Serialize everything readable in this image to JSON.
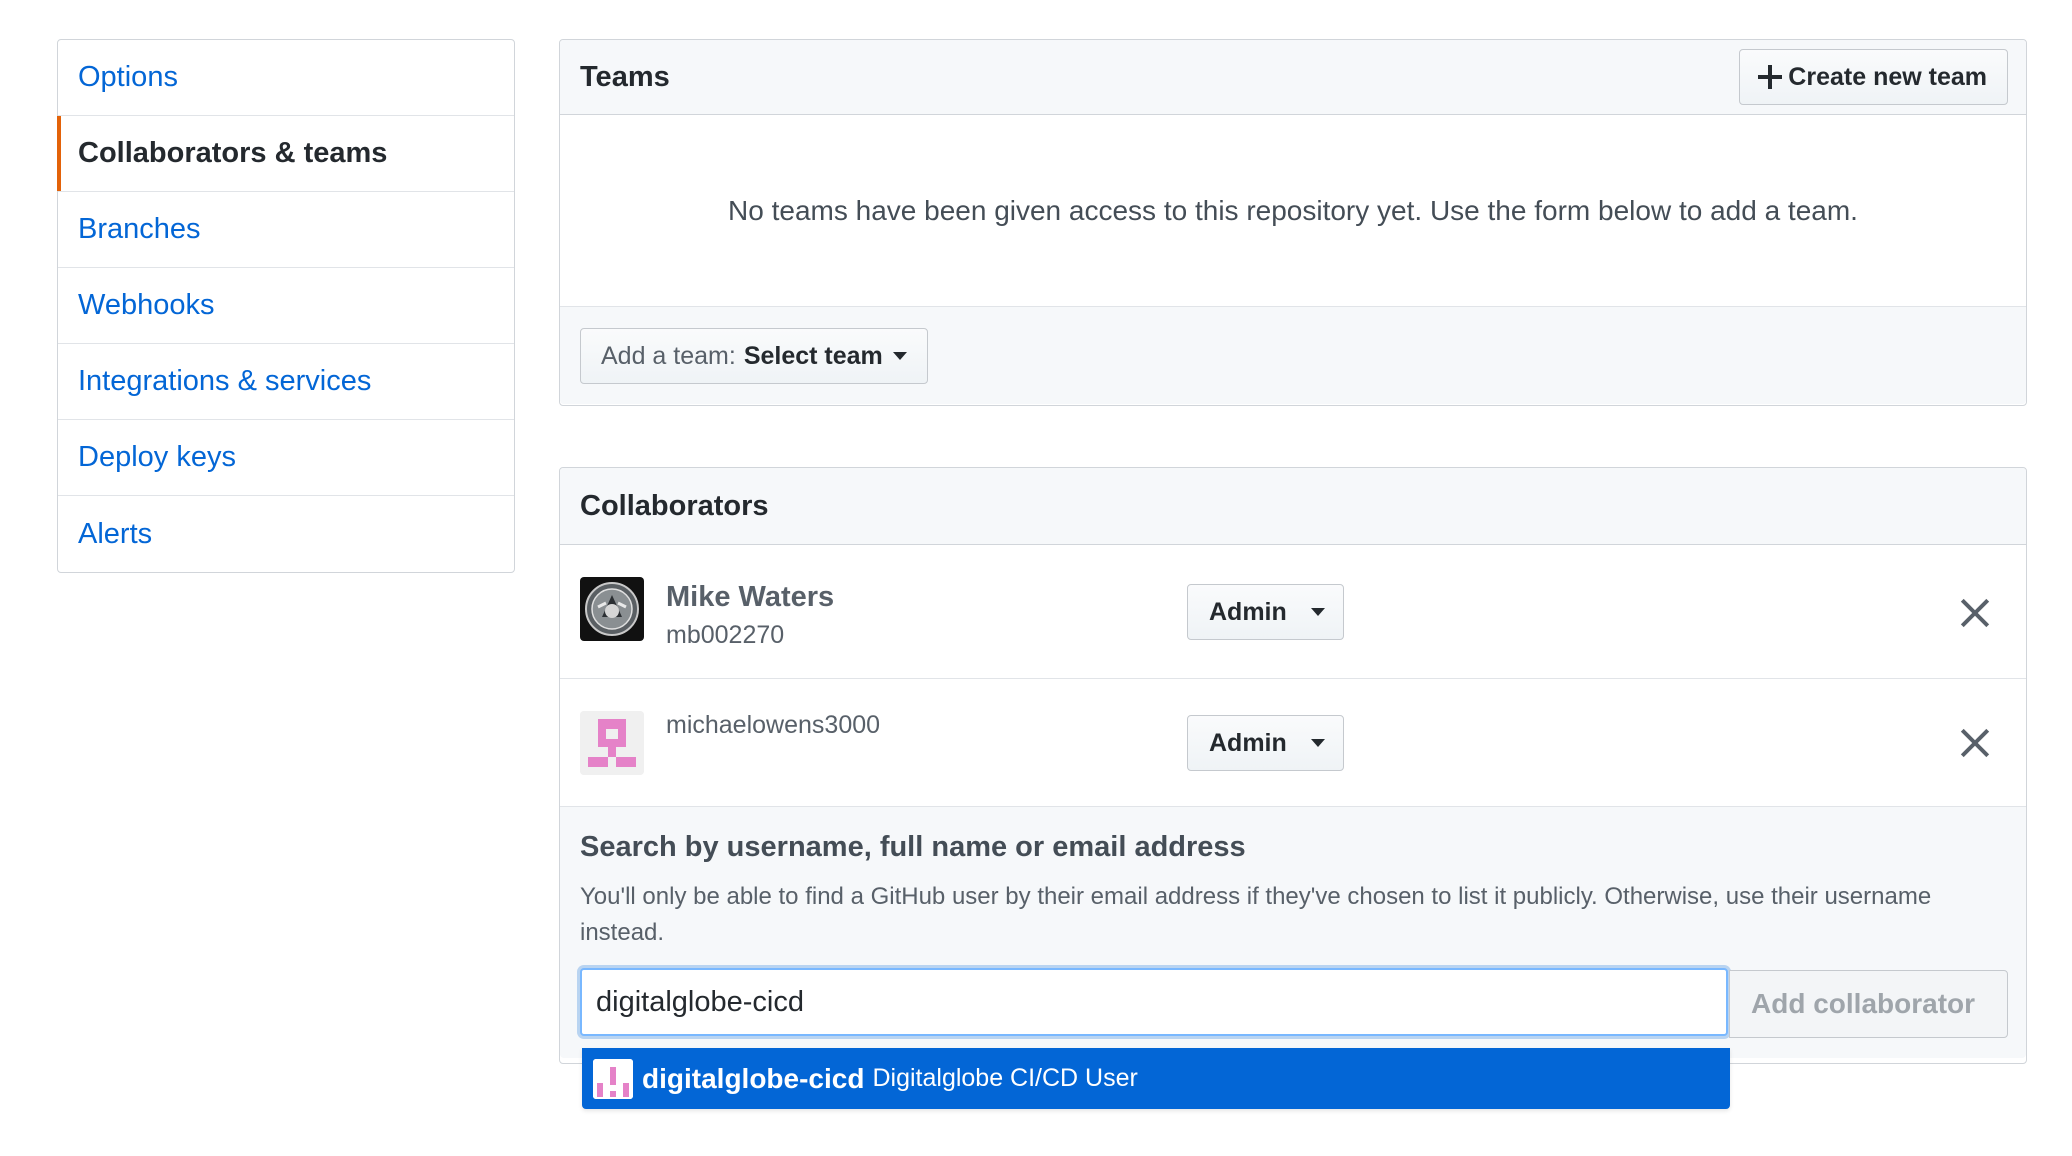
{
  "sidebar": {
    "items": [
      {
        "label": "Options"
      },
      {
        "label": "Collaborators & teams",
        "selected": true
      },
      {
        "label": "Branches"
      },
      {
        "label": "Webhooks"
      },
      {
        "label": "Integrations & services"
      },
      {
        "label": "Deploy keys"
      },
      {
        "label": "Alerts"
      }
    ]
  },
  "teams": {
    "title": "Teams",
    "create_button": "Create new team",
    "empty_message": "No teams have been given access to this repository yet. Use the form below to add a team.",
    "add_team_label": "Add a team:",
    "add_team_value": "Select team"
  },
  "collaborators": {
    "title": "Collaborators",
    "rows": [
      {
        "name": "Mike Waters",
        "login": "mb002270",
        "role": "Admin",
        "avatar_icon": "emblem-avatar-icon"
      },
      {
        "name": "",
        "login": "michaelowens3000",
        "role": "Admin",
        "avatar_icon": "identicon-pink-icon"
      }
    ],
    "search_heading": "Search by username, full name or email address",
    "search_note": "You'll only be able to find a GitHub user by their email address if they've chosen to list it publicly. Otherwise, use their username instead.",
    "search_value": "digitalglobe-cicd",
    "add_button": "Add collaborator",
    "autocomplete": {
      "login": "digitalglobe-cicd",
      "full_name": "Digitalglobe CI/CD User",
      "avatar_icon": "identicon-pink-icon"
    }
  },
  "colors": {
    "link": "#0366d6",
    "selected_accent": "#e36209",
    "highlight": "#0366d6",
    "identicon": "#e582c8"
  }
}
